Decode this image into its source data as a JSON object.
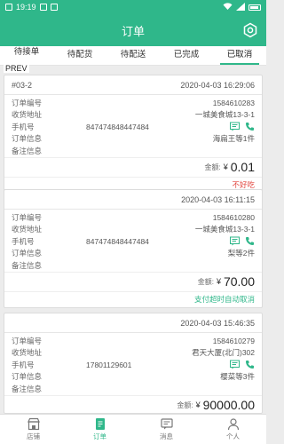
{
  "status_bar": {
    "time": "19:19"
  },
  "header": {
    "title": "订单"
  },
  "tabs": [
    {
      "label": "待接单"
    },
    {
      "label": "待配货"
    },
    {
      "label": "待配送"
    },
    {
      "label": "已完成"
    },
    {
      "label": "已取消"
    }
  ],
  "prev_label": "PREV",
  "field_labels": {
    "order_no": "订单编号",
    "address": "收货地址",
    "phone": "手机号",
    "order_info": "订单信息",
    "remark": "备注信息",
    "amount": "金额:",
    "currency": "¥"
  },
  "orders": [
    {
      "number": "#03-2",
      "timestamp": "2020-04-03 16:29:06",
      "order_no": "1584610283",
      "address": "一城美食城13-3-1",
      "phone": "847474848447484",
      "order_info": "海扁王等1件",
      "remark": "",
      "amount": "0.01",
      "status": "不好吃",
      "status_color": "#e2463f"
    },
    {
      "number": "",
      "timestamp": "2020-04-03 16:11:15",
      "order_no": "1584610280",
      "address": "一城美食城13-3-1",
      "phone": "847474848447484",
      "order_info": "梨等2件",
      "remark": "",
      "amount": "70.00",
      "status": "支付超时自动取消",
      "status_color": "#2fb78a"
    },
    {
      "number": "",
      "timestamp": "2020-04-03 15:46:35",
      "order_no": "1584610279",
      "address": "君天大厦(北门)302",
      "phone": "17801129601",
      "order_info": "樱菜等3件",
      "remark": "",
      "amount": "90000.00",
      "status": "",
      "status_color": "#2fb78a"
    }
  ],
  "bottom_nav": [
    {
      "label": "店铺",
      "icon": "store-icon"
    },
    {
      "label": "订单",
      "icon": "order-icon"
    },
    {
      "label": "消息",
      "icon": "message-icon"
    },
    {
      "label": "个人",
      "icon": "user-icon"
    }
  ],
  "colors": {
    "accent": "#2fb78a",
    "danger": "#e2463f"
  }
}
